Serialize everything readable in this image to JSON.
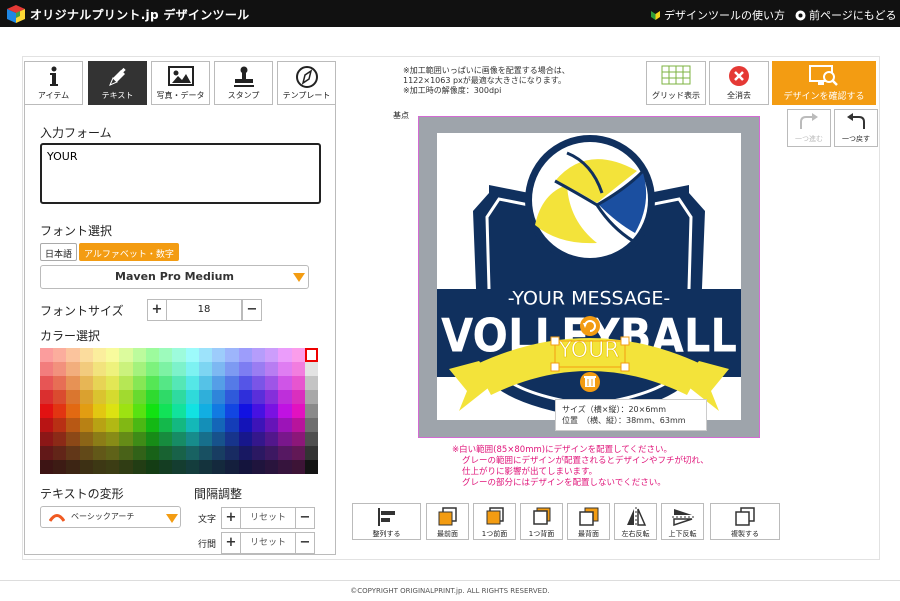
{
  "header": {
    "brand": "オリジナルプリント.jp デザインツール",
    "howto": "デザインツールの使い方",
    "back": "前ページにもどる"
  },
  "tabs": [
    {
      "label": "アイテム",
      "icon": "info-icon"
    },
    {
      "label": "テキスト",
      "icon": "pen-icon"
    },
    {
      "label": "写真・データ",
      "icon": "image-icon"
    },
    {
      "label": "スタンプ",
      "icon": "stamp-icon"
    },
    {
      "label": "テンプレート",
      "icon": "compass-icon"
    }
  ],
  "panel": {
    "input_title": "入力フォーム",
    "input_value": "YOUR",
    "font_title": "フォント選択",
    "lang_jp": "日本語",
    "lang_alpha": "アルファベット・数字",
    "font_name": "Maven Pro Medium",
    "size_title": "フォントサイズ",
    "size_value": "18",
    "color_title": "カラー選択",
    "transform_title": "テキストの変形",
    "transform_value": "ベーシックアーチ",
    "spacing_title": "間隔調整",
    "char_label": "文字",
    "line_label": "行間",
    "reset": "リセット"
  },
  "notes": [
    "※加工範囲いっぱいに画像を配置する場合は、",
    "1122×1063 pxが最適な大きさになります。",
    "※加工時の解像度：300dpi"
  ],
  "tools": {
    "grid": "グリッド表示",
    "clear": "全消去",
    "confirm": "デザインを確認する",
    "redo": "一つ進む",
    "undo": "一つ戻す"
  },
  "canvas": {
    "origin": "基点",
    "message": "-YOUR MESSAGE-",
    "title": "VOLLEYBALL",
    "selected_text": "YOUR",
    "size_label": "サイズ（横×縦）：20×6mm",
    "position_label": "位置　（横、縦）：38mm、63mm"
  },
  "warning": [
    "※白い範囲(85×80mm)にデザインを配置してください。",
    "グレーの範囲にデザインが配置されるとデザインやフチが切れ、",
    "仕上がりに影響が出てしまいます。",
    "グレーの部分にはデザインを配置しないでください。"
  ],
  "bottom_tools": [
    "整列する",
    "最前面",
    "1つ前面",
    "1つ背面",
    "最背面",
    "左右反転",
    "上下反転",
    "複製する"
  ],
  "footer": "©COPYRIGHT ORIGINALPRINT.jp. ALL RIGHTS RESERVED.",
  "colors": {
    "accent": "#f39c12",
    "navy": "#10305e",
    "yellow": "#f3e33a",
    "warning": "#e0157a"
  }
}
